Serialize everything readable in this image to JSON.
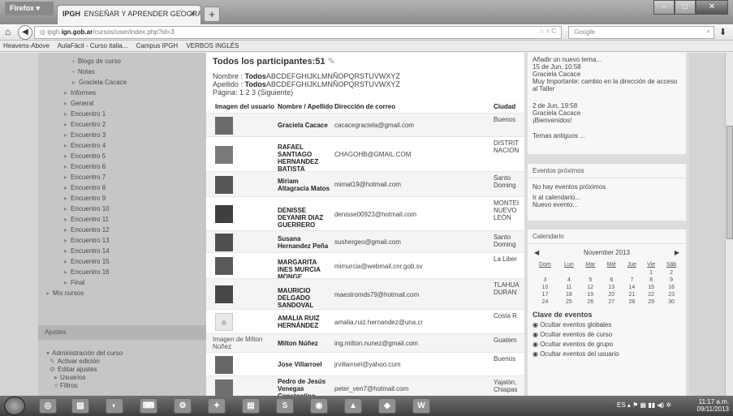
{
  "browser": {
    "app_button": "Firefox ▾",
    "tab_icon": "IPGH",
    "tab_title": "ENSEÑAR Y APRENDER GEOGRAFIA: Par...",
    "new_tab": "+",
    "url_prefix": "ipgh.",
    "url_domain": "ign.gob.ar",
    "url_path": "/cursos/user/index.php?id=3",
    "url_controls": "☆ ▿ C",
    "search_engine": "Google",
    "bookmarks": [
      "Heavens-Above",
      "AulaFácil - Curso italia...",
      "Campus IPGH",
      "VERBOS INGLÉS"
    ]
  },
  "sidebar": {
    "items": [
      {
        "label": "Blogs de curso",
        "bullet": "▪"
      },
      {
        "label": "Notas",
        "bullet": "▪"
      },
      {
        "label": "Graciela Cacace",
        "bullet": "▸"
      },
      {
        "label": "Informes",
        "bullet": "▸"
      },
      {
        "label": "General",
        "bullet": "▸"
      },
      {
        "label": "Encuentro 1",
        "bullet": "▸"
      },
      {
        "label": "Encuentro 2",
        "bullet": "▸"
      },
      {
        "label": "Encuentro 3",
        "bullet": "▸"
      },
      {
        "label": "Encuentro 4",
        "bullet": "▸"
      },
      {
        "label": "Encuentro 5",
        "bullet": "▸"
      },
      {
        "label": "Encuentro 6",
        "bullet": "▸"
      },
      {
        "label": "Encuentro 7",
        "bullet": "▸"
      },
      {
        "label": "Encuentro 8",
        "bullet": "▸"
      },
      {
        "label": "Encuentro 9",
        "bullet": "▸"
      },
      {
        "label": "Encuentro 10",
        "bullet": "▸"
      },
      {
        "label": "Encuentro 11",
        "bullet": "▸"
      },
      {
        "label": "Encuentro 12",
        "bullet": "▸"
      },
      {
        "label": "Encuentro 13",
        "bullet": "▸"
      },
      {
        "label": "Encuentro 14",
        "bullet": "▸"
      },
      {
        "label": "Encuentro 15",
        "bullet": "▸"
      },
      {
        "label": "Encuentro 16",
        "bullet": "▸"
      },
      {
        "label": "Final",
        "bullet": "▸"
      },
      {
        "label": "Mis cursos",
        "bullet": "▸"
      }
    ],
    "ajustes_heading": "Ajustes",
    "admin_items": [
      {
        "label": "Administración del curso",
        "bullet": "▾"
      },
      {
        "label": "Activar edición",
        "bullet": "✎"
      },
      {
        "label": "Editar ajustes",
        "bullet": "⚙"
      },
      {
        "label": "Usuarios",
        "bullet": "▸"
      },
      {
        "label": "Filtros",
        "bullet": "▿"
      }
    ]
  },
  "main": {
    "title": "Todos los participantes:51",
    "nombre_label": "Nombre :",
    "apellido_label": "Apellido :",
    "todos": "Todos",
    "letters": "ABCDEFGHIJKLMNÑOPQRSTUVWXYZ",
    "pagina_label": "Página:",
    "pages": "1 2 3",
    "siguiente": "(Siguiente)",
    "columns": [
      "Imagen del usuario",
      "Nombre / Apellido",
      "Dirección de correo",
      "Ciudad"
    ],
    "rows": [
      {
        "name": "Graciela Cacace",
        "email": "cacacegraciela@gmail.com",
        "city": "Buenos",
        "pic": "photo"
      },
      {
        "name": "RAFAEL SANTIAGO HERNANDEZ BATISTA",
        "email": "CHAGOHB@GMAIL.COM",
        "city": "DISTRIT NACION",
        "pic": "photo"
      },
      {
        "name": "Miriam Altagracia Matos",
        "email": "mimat19@hotmail.com",
        "city": "Santo Doming",
        "pic": "photo"
      },
      {
        "name": "DENISSE DEYANIR DIAZ GUERRERO",
        "email": "denisse00923@hotmail.com",
        "city": "MONTEI NUEVO LEÓN",
        "pic": "photo"
      },
      {
        "name": "Susana Hernandez Peña",
        "email": "sushergeo@gmail.com",
        "city": "Santo Doming",
        "pic": "photo"
      },
      {
        "name": "MARGARITA INES MURCIA MONGE",
        "email": "mimurcia@webmail.cnr.gob.sv",
        "city": "La Liber",
        "pic": "photo"
      },
      {
        "name": "MAURICIO DELGADO SANDOVAL",
        "email": "maestromds79@hotmail.com",
        "city": "TLAHUA DURAN",
        "pic": "photo"
      },
      {
        "name": "AMALIA RUIZ HERNÁNDEZ",
        "email": "amalia.ruiz.hernandez@una.cr",
        "city": "Costa R",
        "pic": "default"
      },
      {
        "name": "Milton Núñez",
        "email": "ing.milton.nunez@gmail.com",
        "city": "Guatem",
        "pic": "none",
        "alt": "Imagen de Milton Núñez"
      },
      {
        "name": "Jose Villarroel",
        "email": "jrvillarroel@yahoo.com",
        "city": "Buenos",
        "pic": "photo"
      },
      {
        "name": "Pedro de Jesús Venegas Constantino",
        "email": "peter_ven7@hotmail.com",
        "city": "Yajalón, Chiapas",
        "pic": "photo"
      }
    ]
  },
  "rightcol": {
    "forum_add": "Añadir un nuevo tema...",
    "post1_date": "15 de Jun, 10:58",
    "post1_author": "Graciela Cacace",
    "post1_text": "Muy Importante: cambio en la dirección de acceso al Taller",
    "post2_date": "2 de Jun, 19:58",
    "post2_author": "Graciela Cacace",
    "post2_text": "¡Bienvenidos!",
    "old_topics": "Temas antiguos ...",
    "events_heading": "Eventos próximos",
    "no_events": "No hay eventos próximos",
    "go_calendar": "Ir al calendario...",
    "new_event": "Nuevo evento...",
    "calendar_heading": "Calendario",
    "month": "November 2013",
    "weekdays": [
      "Dom",
      "Lun",
      "Mar",
      "Mié",
      "Jue",
      "Vie",
      "Sáb"
    ],
    "weeks": [
      [
        "",
        "",
        "",
        "",
        "",
        "1",
        "2"
      ],
      [
        "3",
        "4",
        "5",
        "6",
        "7",
        "8",
        "9"
      ],
      [
        "10",
        "11",
        "12",
        "13",
        "14",
        "15",
        "16"
      ],
      [
        "17",
        "18",
        "19",
        "20",
        "21",
        "22",
        "23"
      ],
      [
        "24",
        "25",
        "26",
        "27",
        "28",
        "29",
        "30"
      ]
    ],
    "key_heading": "Clave de eventos",
    "key_items": [
      "Ocultar eventos globales",
      "Ocultar eventos de curso",
      "Ocultar eventos de grupo",
      "Ocultar eventos del usuario"
    ]
  },
  "taskbar": {
    "lang": "ES",
    "time": "11:17 a.m.",
    "date": "09/11/2013",
    "word_label": "W",
    "skype_label": "S"
  }
}
